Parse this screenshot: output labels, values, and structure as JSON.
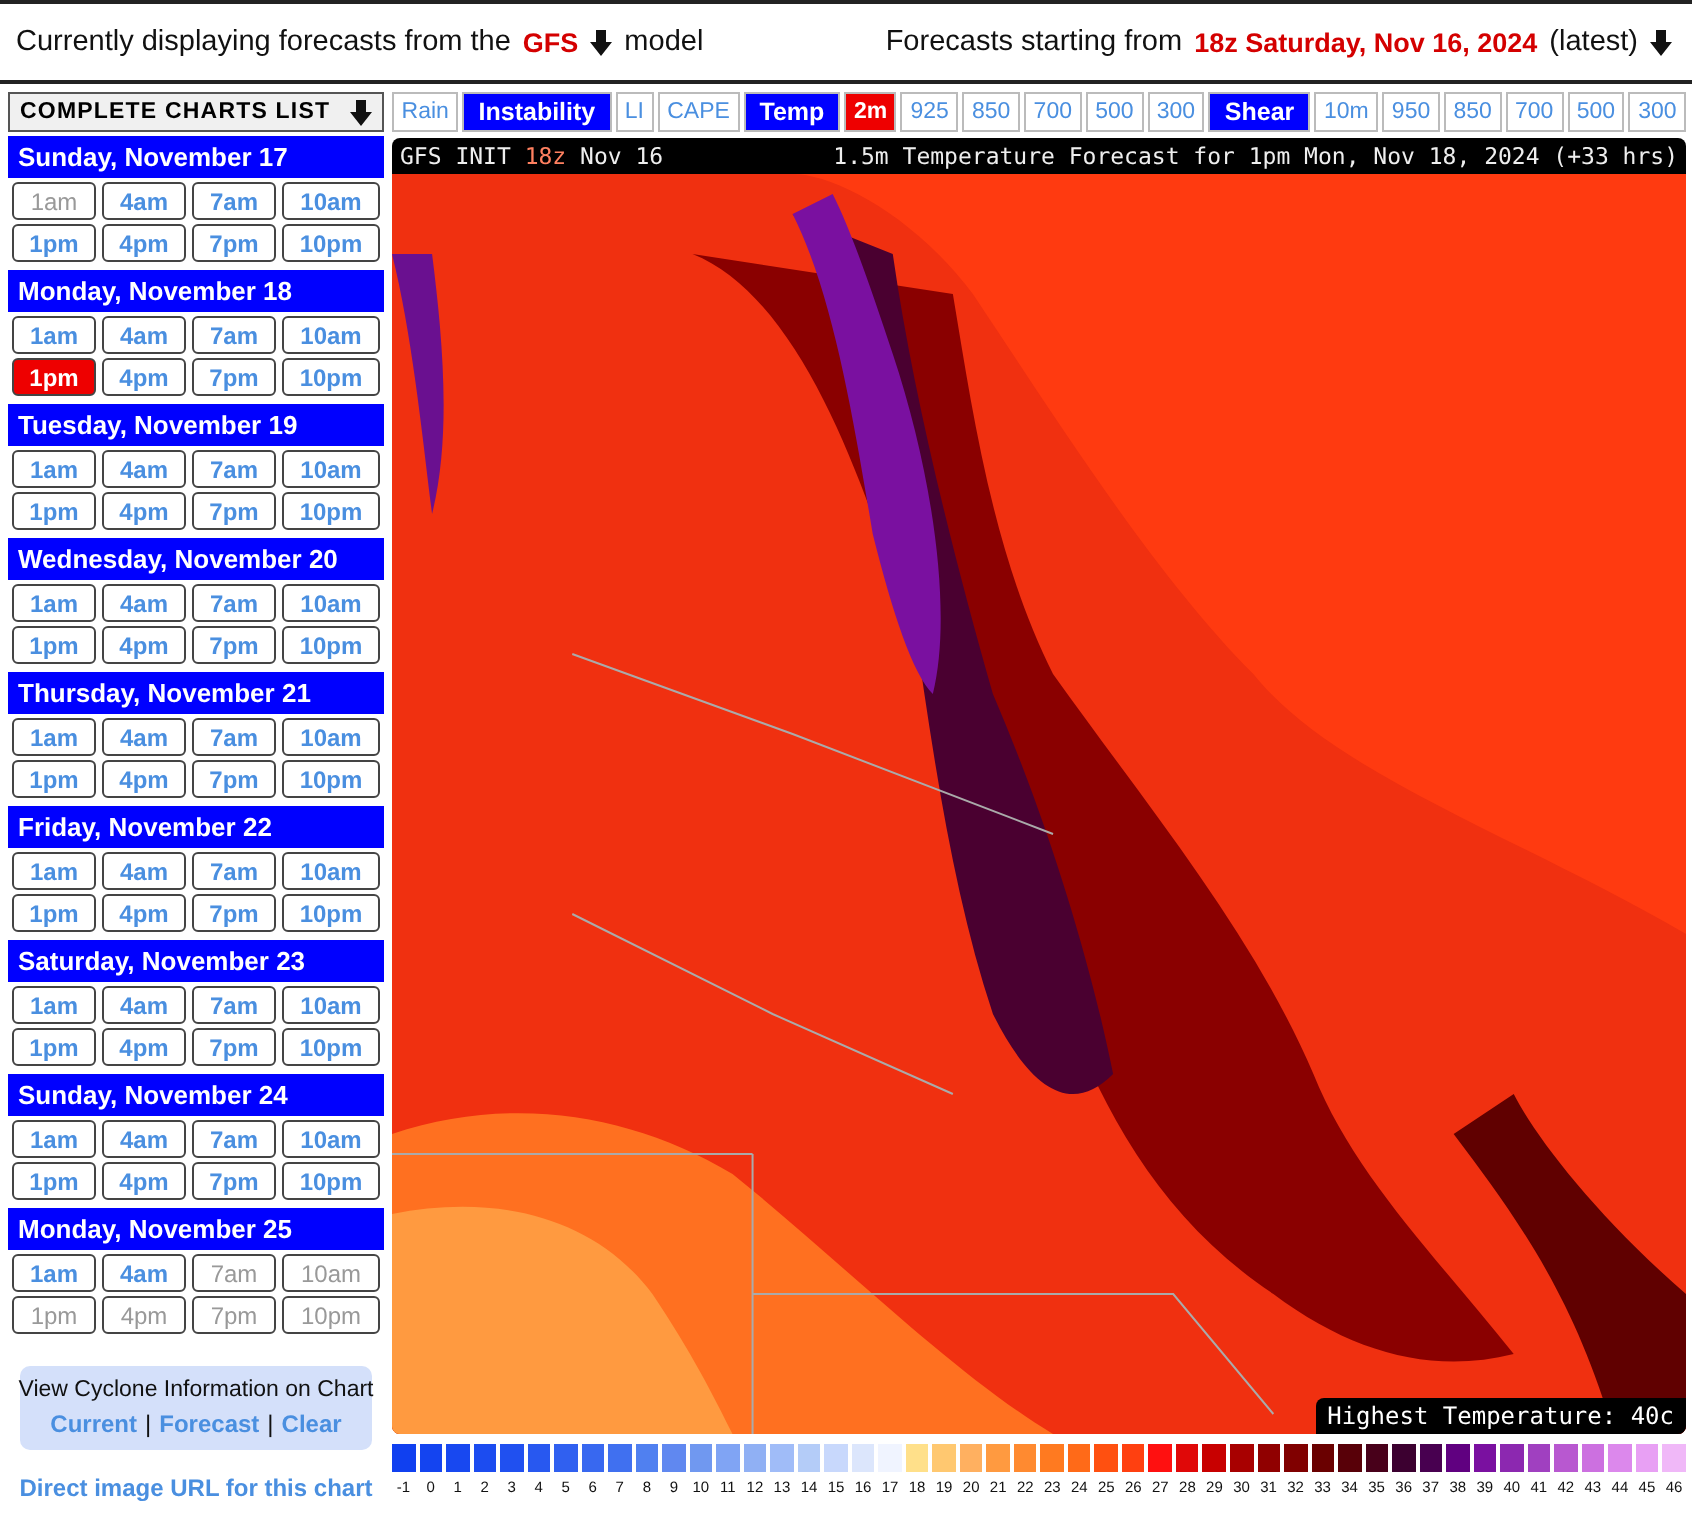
{
  "header": {
    "model_prefix": "Currently displaying forecasts from the",
    "model": "GFS",
    "model_suffix": "model",
    "start_prefix": "Forecasts starting from",
    "start": "18z Saturday, Nov 16, 2024",
    "start_suffix": "(latest)"
  },
  "sidebar": {
    "title": "COMPLETE CHARTS LIST",
    "days": [
      {
        "label": "Sunday, November 17",
        "slots": [
          {
            "label": "1am",
            "selected": false,
            "disabled": true
          },
          {
            "label": "4am",
            "selected": false,
            "disabled": false
          },
          {
            "label": "7am",
            "selected": false,
            "disabled": false
          },
          {
            "label": "10am",
            "selected": false,
            "disabled": false
          },
          {
            "label": "1pm",
            "selected": false,
            "disabled": false
          },
          {
            "label": "4pm",
            "selected": false,
            "disabled": false
          },
          {
            "label": "7pm",
            "selected": false,
            "disabled": false
          },
          {
            "label": "10pm",
            "selected": false,
            "disabled": false
          }
        ]
      },
      {
        "label": "Monday, November 18",
        "slots": [
          {
            "label": "1am",
            "selected": false,
            "disabled": false
          },
          {
            "label": "4am",
            "selected": false,
            "disabled": false
          },
          {
            "label": "7am",
            "selected": false,
            "disabled": false
          },
          {
            "label": "10am",
            "selected": false,
            "disabled": false
          },
          {
            "label": "1pm",
            "selected": true,
            "disabled": false
          },
          {
            "label": "4pm",
            "selected": false,
            "disabled": false
          },
          {
            "label": "7pm",
            "selected": false,
            "disabled": false
          },
          {
            "label": "10pm",
            "selected": false,
            "disabled": false
          }
        ]
      },
      {
        "label": "Tuesday, November 19",
        "slots": [
          {
            "label": "1am",
            "selected": false,
            "disabled": false
          },
          {
            "label": "4am",
            "selected": false,
            "disabled": false
          },
          {
            "label": "7am",
            "selected": false,
            "disabled": false
          },
          {
            "label": "10am",
            "selected": false,
            "disabled": false
          },
          {
            "label": "1pm",
            "selected": false,
            "disabled": false
          },
          {
            "label": "4pm",
            "selected": false,
            "disabled": false
          },
          {
            "label": "7pm",
            "selected": false,
            "disabled": false
          },
          {
            "label": "10pm",
            "selected": false,
            "disabled": false
          }
        ]
      },
      {
        "label": "Wednesday, November 20",
        "slots": [
          {
            "label": "1am",
            "selected": false,
            "disabled": false
          },
          {
            "label": "4am",
            "selected": false,
            "disabled": false
          },
          {
            "label": "7am",
            "selected": false,
            "disabled": false
          },
          {
            "label": "10am",
            "selected": false,
            "disabled": false
          },
          {
            "label": "1pm",
            "selected": false,
            "disabled": false
          },
          {
            "label": "4pm",
            "selected": false,
            "disabled": false
          },
          {
            "label": "7pm",
            "selected": false,
            "disabled": false
          },
          {
            "label": "10pm",
            "selected": false,
            "disabled": false
          }
        ]
      },
      {
        "label": "Thursday, November 21",
        "slots": [
          {
            "label": "1am",
            "selected": false,
            "disabled": false
          },
          {
            "label": "4am",
            "selected": false,
            "disabled": false
          },
          {
            "label": "7am",
            "selected": false,
            "disabled": false
          },
          {
            "label": "10am",
            "selected": false,
            "disabled": false
          },
          {
            "label": "1pm",
            "selected": false,
            "disabled": false
          },
          {
            "label": "4pm",
            "selected": false,
            "disabled": false
          },
          {
            "label": "7pm",
            "selected": false,
            "disabled": false
          },
          {
            "label": "10pm",
            "selected": false,
            "disabled": false
          }
        ]
      },
      {
        "label": "Friday, November 22",
        "slots": [
          {
            "label": "1am",
            "selected": false,
            "disabled": false
          },
          {
            "label": "4am",
            "selected": false,
            "disabled": false
          },
          {
            "label": "7am",
            "selected": false,
            "disabled": false
          },
          {
            "label": "10am",
            "selected": false,
            "disabled": false
          },
          {
            "label": "1pm",
            "selected": false,
            "disabled": false
          },
          {
            "label": "4pm",
            "selected": false,
            "disabled": false
          },
          {
            "label": "7pm",
            "selected": false,
            "disabled": false
          },
          {
            "label": "10pm",
            "selected": false,
            "disabled": false
          }
        ]
      },
      {
        "label": "Saturday, November 23",
        "slots": [
          {
            "label": "1am",
            "selected": false,
            "disabled": false
          },
          {
            "label": "4am",
            "selected": false,
            "disabled": false
          },
          {
            "label": "7am",
            "selected": false,
            "disabled": false
          },
          {
            "label": "10am",
            "selected": false,
            "disabled": false
          },
          {
            "label": "1pm",
            "selected": false,
            "disabled": false
          },
          {
            "label": "4pm",
            "selected": false,
            "disabled": false
          },
          {
            "label": "7pm",
            "selected": false,
            "disabled": false
          },
          {
            "label": "10pm",
            "selected": false,
            "disabled": false
          }
        ]
      },
      {
        "label": "Sunday, November 24",
        "slots": [
          {
            "label": "1am",
            "selected": false,
            "disabled": false
          },
          {
            "label": "4am",
            "selected": false,
            "disabled": false
          },
          {
            "label": "7am",
            "selected": false,
            "disabled": false
          },
          {
            "label": "10am",
            "selected": false,
            "disabled": false
          },
          {
            "label": "1pm",
            "selected": false,
            "disabled": false
          },
          {
            "label": "4pm",
            "selected": false,
            "disabled": false
          },
          {
            "label": "7pm",
            "selected": false,
            "disabled": false
          },
          {
            "label": "10pm",
            "selected": false,
            "disabled": false
          }
        ]
      },
      {
        "label": "Monday, November 25",
        "slots": [
          {
            "label": "1am",
            "selected": false,
            "disabled": false
          },
          {
            "label": "4am",
            "selected": false,
            "disabled": false
          },
          {
            "label": "7am",
            "selected": false,
            "disabled": true
          },
          {
            "label": "10am",
            "selected": false,
            "disabled": true
          },
          {
            "label": "1pm",
            "selected": false,
            "disabled": true
          },
          {
            "label": "4pm",
            "selected": false,
            "disabled": true
          },
          {
            "label": "7pm",
            "selected": false,
            "disabled": true
          },
          {
            "label": "10pm",
            "selected": false,
            "disabled": true
          }
        ]
      }
    ],
    "cyclone": {
      "title": "View Cyclone Information on Chart",
      "links": [
        "Current",
        "Forecast",
        "Clear"
      ],
      "separator": "|"
    },
    "image_url_link": "Direct image URL for this chart"
  },
  "tabs": [
    {
      "label": "Rain",
      "kind": "link",
      "selected": false
    },
    {
      "label": "Instability",
      "kind": "group",
      "selected": false
    },
    {
      "label": "LI",
      "kind": "link",
      "selected": false
    },
    {
      "label": "CAPE",
      "kind": "link",
      "selected": false
    },
    {
      "label": "Temp",
      "kind": "group",
      "selected": false
    },
    {
      "label": "2m",
      "kind": "link",
      "selected": true
    },
    {
      "label": "925",
      "kind": "link",
      "selected": false
    },
    {
      "label": "850",
      "kind": "link",
      "selected": false
    },
    {
      "label": "700",
      "kind": "link",
      "selected": false
    },
    {
      "label": "500",
      "kind": "link",
      "selected": false
    },
    {
      "label": "300",
      "kind": "link",
      "selected": false
    },
    {
      "label": "Shear",
      "kind": "group",
      "selected": false
    },
    {
      "label": "10m",
      "kind": "link",
      "selected": false
    },
    {
      "label": "950",
      "kind": "link",
      "selected": false
    },
    {
      "label": "850",
      "kind": "link",
      "selected": false
    },
    {
      "label": "700",
      "kind": "link",
      "selected": false
    },
    {
      "label": "500",
      "kind": "link",
      "selected": false
    },
    {
      "label": "300",
      "kind": "link",
      "selected": false
    }
  ],
  "chart": {
    "init_prefix": "GFS INIT",
    "init_run": "18z",
    "init_date": "Nov 16",
    "title": "1.5m Temperature Forecast for 1pm Mon, Nov 18, 2024 (+33 hrs)",
    "highest": "Highest Temperature: 40c"
  },
  "legend": [
    {
      "label": "-1",
      "color": "#1040f0"
    },
    {
      "label": "0",
      "color": "#1444f0"
    },
    {
      "label": "1",
      "color": "#1848f0"
    },
    {
      "label": "2",
      "color": "#1c4cf0"
    },
    {
      "label": "3",
      "color": "#2050f0"
    },
    {
      "label": "4",
      "color": "#2858f0"
    },
    {
      "label": "5",
      "color": "#3060f0"
    },
    {
      "label": "6",
      "color": "#3868f0"
    },
    {
      "label": "7",
      "color": "#4070f0"
    },
    {
      "label": "8",
      "color": "#5080f0"
    },
    {
      "label": "9",
      "color": "#6088f0"
    },
    {
      "label": "10",
      "color": "#7098f0"
    },
    {
      "label": "11",
      "color": "#80a4f4"
    },
    {
      "label": "12",
      "color": "#90b0f4"
    },
    {
      "label": "13",
      "color": "#a0bcf8"
    },
    {
      "label": "14",
      "color": "#b4ccf8"
    },
    {
      "label": "15",
      "color": "#c8d8fc"
    },
    {
      "label": "16",
      "color": "#dce6fc"
    },
    {
      "label": "17",
      "color": "#f0f4ff"
    },
    {
      "label": "18",
      "color": "#ffe08a"
    },
    {
      "label": "19",
      "color": "#ffc870"
    },
    {
      "label": "20",
      "color": "#ffb060"
    },
    {
      "label": "21",
      "color": "#ff9a40"
    },
    {
      "label": "22",
      "color": "#ff8a30"
    },
    {
      "label": "23",
      "color": "#ff7a20"
    },
    {
      "label": "24",
      "color": "#ff6a18"
    },
    {
      "label": "25",
      "color": "#ff5010"
    },
    {
      "label": "26",
      "color": "#ff4010"
    },
    {
      "label": "27",
      "color": "#ff1010"
    },
    {
      "label": "28",
      "color": "#e00808"
    },
    {
      "label": "29",
      "color": "#c80000"
    },
    {
      "label": "30",
      "color": "#a80000"
    },
    {
      "label": "31",
      "color": "#900000"
    },
    {
      "label": "32",
      "color": "#800000"
    },
    {
      "label": "33",
      "color": "#6a0000"
    },
    {
      "label": "34",
      "color": "#580008"
    },
    {
      "label": "35",
      "color": "#48001a"
    },
    {
      "label": "36",
      "color": "#3c0030"
    },
    {
      "label": "37",
      "color": "#480050"
    },
    {
      "label": "38",
      "color": "#600080"
    },
    {
      "label": "39",
      "color": "#7a10a0"
    },
    {
      "label": "40",
      "color": "#8c28b0"
    },
    {
      "label": "41",
      "color": "#a040c0"
    },
    {
      "label": "42",
      "color": "#b858d0"
    },
    {
      "label": "43",
      "color": "#cc70e0"
    },
    {
      "label": "44",
      "color": "#dc88ec"
    },
    {
      "label": "45",
      "color": "#e8a0f4"
    },
    {
      "label": "46",
      "color": "#f0b8f8"
    }
  ]
}
